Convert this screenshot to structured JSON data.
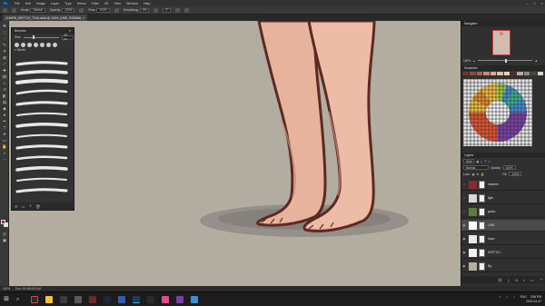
{
  "app": {
    "logo": "Ps"
  },
  "menu": [
    "File",
    "Edit",
    "Image",
    "Layer",
    "Type",
    "Select",
    "Filter",
    "3D",
    "View",
    "Window",
    "Help"
  ],
  "options": {
    "mode_label": "Mode:",
    "mode": "Normal",
    "opacity_label": "Opacity:",
    "opacity": "100%",
    "flow_label": "Flow:",
    "flow": "100%",
    "smoothing_label": "Smoothing:",
    "smoothing": "0%",
    "angle": "0°"
  },
  "document": {
    "tab_title": "CHARB_SKETCH_TEALdraft @ 100% (LINE, RGB/8#)"
  },
  "brushes_panel": {
    "title": "Brushes",
    "size_label": "Size:",
    "size": "30 px",
    "group_label": "Sketch"
  },
  "navigator": {
    "title": "Navigator",
    "zoom": "100%"
  },
  "swatches": {
    "title": "Swatches"
  },
  "layers": {
    "title": "Layers",
    "kind_label": "Kind",
    "blend": "Normal",
    "opacity_label": "Opacity:",
    "opacity": "100%",
    "lock_label": "Lock:",
    "fill_label": "Fill:",
    "fill": "100%",
    "items": [
      {
        "name": "shadow",
        "thumb": "#8b2a33",
        "visible": false
      },
      {
        "name": "light",
        "thumb": "#d8d8d8",
        "visible": false
      },
      {
        "name": "grass",
        "thumb": "#5c7d3d",
        "visible": false
      },
      {
        "name": "LINE",
        "thumb": "#ffffff",
        "visible": true
      },
      {
        "name": "base",
        "thumb": "#e8e8e8",
        "visible": true
      },
      {
        "name": "SKETCH",
        "thumb": "#f2f2f2",
        "visible": true
      },
      {
        "name": "Bg",
        "thumb": "#b4ada2",
        "visible": true
      }
    ]
  },
  "status": {
    "zoom": "100%",
    "doc": "Doc: 26.4M/420.4M"
  },
  "taskbar": {
    "time": "2:56 PM",
    "date": "2022-04-27",
    "lang": "ENG"
  },
  "colors": {
    "accent_red": "#c73a3a",
    "skin": "#e9b9a3",
    "line": "#5c2a22",
    "bg": "#b3aca1"
  }
}
